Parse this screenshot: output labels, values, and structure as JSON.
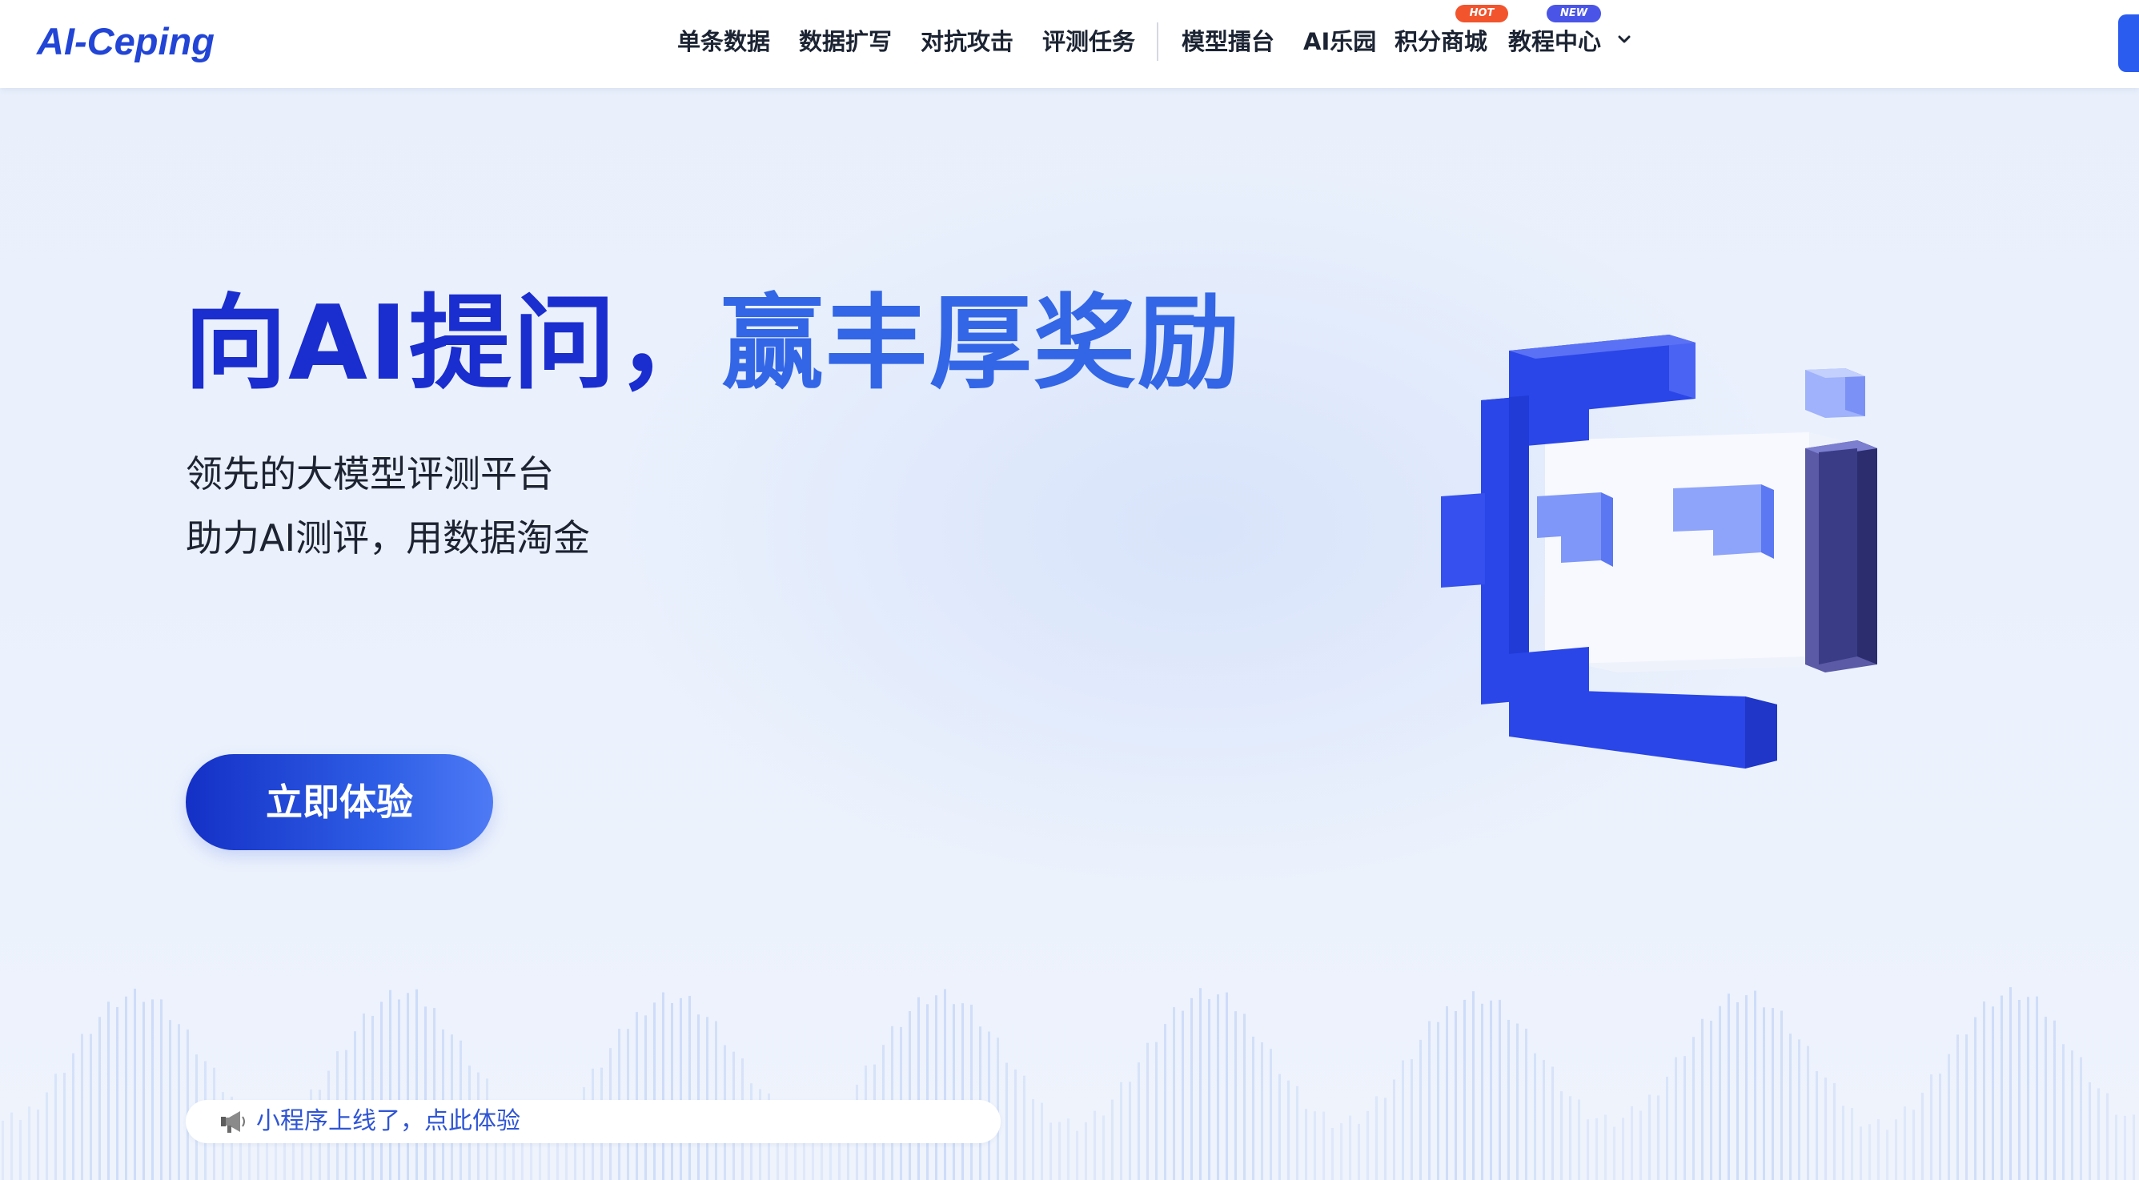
{
  "navbar": {
    "logo": "AI-Ceping",
    "items": [
      {
        "label": "单条数据"
      },
      {
        "label": "数据扩写"
      },
      {
        "label": "对抗攻击"
      },
      {
        "label": "评测任务"
      },
      {
        "label": "模型擂台"
      },
      {
        "label": "AI乐园"
      },
      {
        "label": "积分商城",
        "badge": "HOT"
      },
      {
        "label": "教程中心",
        "badge": "NEW"
      }
    ],
    "more_icon": "chevron-down-icon"
  },
  "hero": {
    "title_part1": "向AI提问，",
    "title_part2": "赢丰厚奖励",
    "subtitle_line1": "领先的大模型评测平台",
    "subtitle_line2": "助力AI测评，用数据淘金",
    "cta_label": "立即体验"
  },
  "notice": {
    "icon": "megaphone-icon",
    "text": "小程序上线了，点此体验"
  },
  "colors": {
    "brand": "#2245d6",
    "title_dark": "#1a2dcf",
    "title_light": "#3366e6",
    "hot_badge": "#f2542d",
    "new_badge": "#4a55e8"
  }
}
